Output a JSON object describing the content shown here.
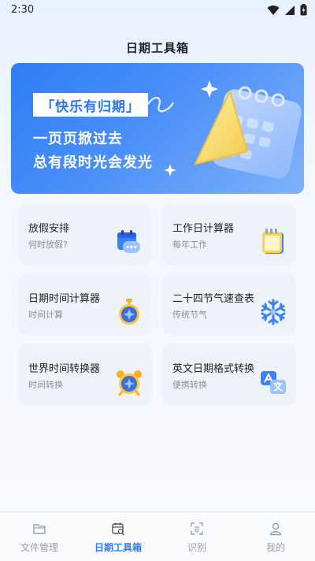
{
  "status_bar": {
    "time": "2:30"
  },
  "app": {
    "title": "日期工具箱"
  },
  "banner": {
    "tag": "「快乐有归期」",
    "line1": "一页页掀过去",
    "line2": "总有段时光会发光"
  },
  "cards": [
    {
      "title": "放假安排",
      "subtitle": "何时放假?",
      "icon": "calendar-chat-icon"
    },
    {
      "title": "工作日计算器",
      "subtitle": "每年工作",
      "icon": "calendar-icon"
    },
    {
      "title": "日期时间计算器",
      "subtitle": "时间计算",
      "icon": "stopwatch-icon"
    },
    {
      "title": "二十四节气速查表",
      "subtitle": "传统节气",
      "icon": "snowflake-icon"
    },
    {
      "title": "世界时间转换器",
      "subtitle": "时间转换",
      "icon": "alarm-clock-icon"
    },
    {
      "title": "英文日期格式转换",
      "subtitle": "便携转换",
      "icon": "translate-icon"
    }
  ],
  "tabs": [
    {
      "label": "文件管理",
      "icon": "folder-icon"
    },
    {
      "label": "日期工具箱",
      "icon": "calendar-search-icon",
      "active": true
    },
    {
      "label": "识别",
      "icon": "scan-icon"
    },
    {
      "label": "我的",
      "icon": "user-icon"
    }
  ],
  "colors": {
    "accent": "#2f7df6",
    "banner_start": "#2f7df6",
    "banner_end": "#7fb2fb"
  }
}
